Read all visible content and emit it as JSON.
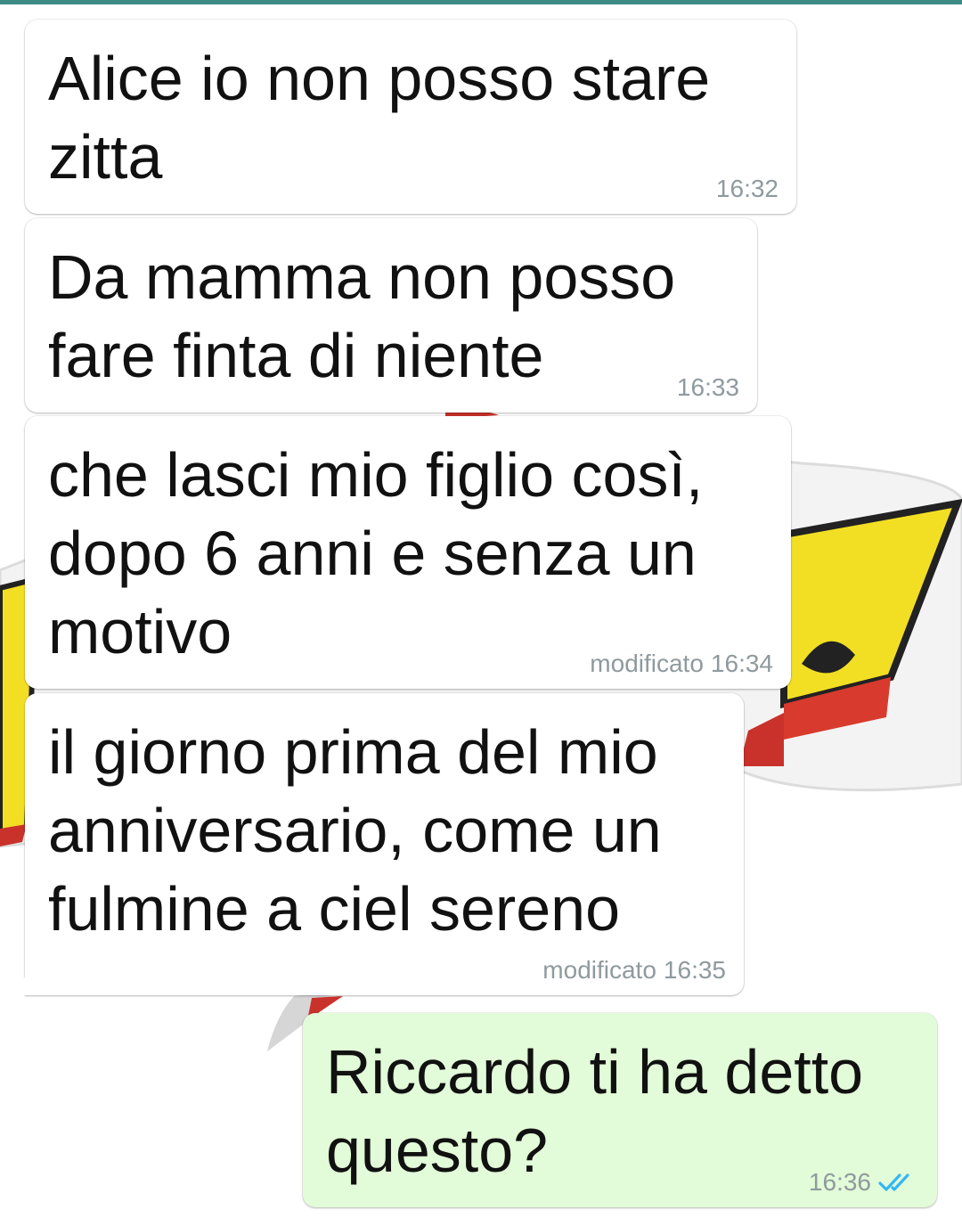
{
  "messages": [
    {
      "direction": "incoming",
      "text": "Alice io non posso stare zitta",
      "time": "16:32",
      "edited_label": ""
    },
    {
      "direction": "incoming",
      "text": "Da mamma non posso fare finta di niente",
      "time": "16:33",
      "edited_label": ""
    },
    {
      "direction": "incoming",
      "text": "che lasci mio figlio così, dopo 6 anni e senza un motivo",
      "time": "16:34",
      "edited_label": "modificato"
    },
    {
      "direction": "incoming",
      "text": "il giorno prima del mio anniversario, come un fulmine a ciel sereno",
      "time": "16:35",
      "edited_label": "modificato"
    },
    {
      "direction": "outgoing",
      "text": "Riccardo ti ha detto questo?",
      "time": "16:36",
      "edited_label": "",
      "status_icon": "double-check-read-icon"
    }
  ],
  "colors": {
    "accent_bar": "#3e8b86",
    "incoming_bubble": "#ffffff",
    "outgoing_bubble": "#e2fbd8",
    "read_ticks": "#34b7f1",
    "timestamp": "#8f9a9e"
  }
}
